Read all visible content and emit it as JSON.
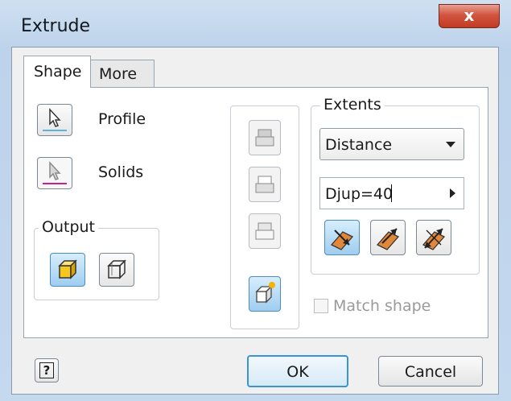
{
  "window": {
    "title": "Extrude",
    "close_label": "x"
  },
  "tabs": [
    {
      "label": "Shape"
    },
    {
      "label": "More"
    }
  ],
  "selection": {
    "profile_label": "Profile",
    "solids_label": "Solids"
  },
  "output": {
    "group_label": "Output"
  },
  "extents": {
    "group_label": "Extents",
    "type_value": "Distance",
    "distance_value": "Djup=40"
  },
  "match_shape_label": "Match shape",
  "buttons": {
    "ok": "OK",
    "cancel": "Cancel",
    "help_glyph": "?"
  },
  "colors": {
    "accent": "#bfe0f7",
    "close": "#c94a33"
  }
}
